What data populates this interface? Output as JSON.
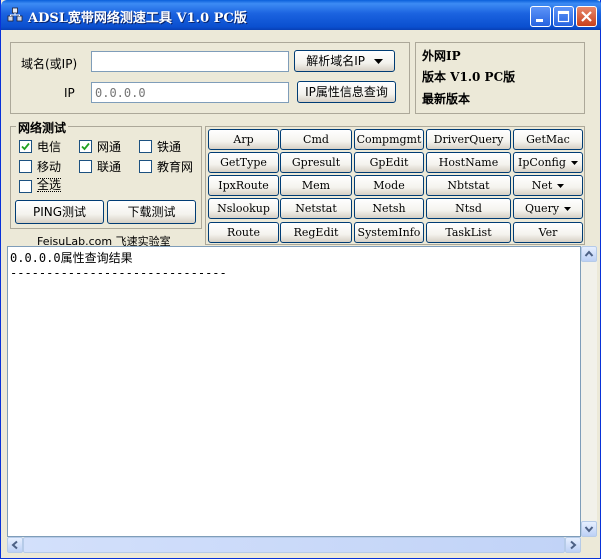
{
  "window": {
    "title": "ADSL宽带网络测速工具 V1.0 PC版"
  },
  "domain_form": {
    "domain_label": "域名(或IP)",
    "domain_value": "",
    "ip_label": "IP",
    "ip_placeholder": "0.0.0.0",
    "resolve_button": "解析域名IP",
    "ipinfo_button": "IP属性信息查询"
  },
  "info": {
    "line1": "外网IP",
    "line2": "版本 V1.0 PC版",
    "line3": "最新版本"
  },
  "network_test": {
    "title": "网络测试",
    "options": [
      {
        "label": "电信",
        "checked": true
      },
      {
        "label": "网通",
        "checked": true
      },
      {
        "label": "铁通",
        "checked": false
      },
      {
        "label": "移动",
        "checked": false
      },
      {
        "label": "联通",
        "checked": false
      },
      {
        "label": "教育网",
        "checked": false
      },
      {
        "label": "全选",
        "checked": false
      }
    ],
    "ping_button": "PING测试",
    "download_button": "下载测试",
    "footer": "FeisuLab.com 飞速实验室"
  },
  "commands": [
    [
      "Arp",
      "Cmd",
      "Compmgmt",
      "DriverQuery",
      "GetMac"
    ],
    [
      "GetType",
      "Gpresult",
      "GpEdit",
      "HostName",
      "IpConfig"
    ],
    [
      "IpxRoute",
      "Mem",
      "Mode",
      "Nbtstat",
      "Net"
    ],
    [
      "Nslookup",
      "Netstat",
      "Netsh",
      "Ntsd",
      "Query"
    ],
    [
      "Route",
      "RegEdit",
      "SystemInfo",
      "TaskList",
      "Ver"
    ]
  ],
  "result": {
    "text": "0.0.0.0属性查询结果\n------------------------------"
  }
}
